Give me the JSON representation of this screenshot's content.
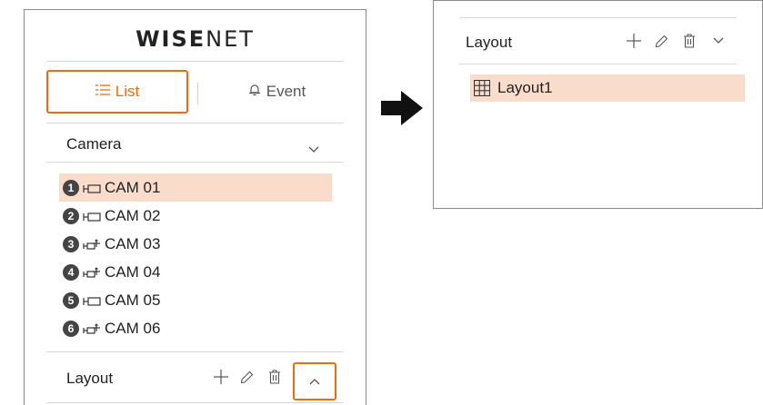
{
  "left_panel": {
    "logo_bold": "WISE",
    "logo_thin": "NET",
    "tabs": [
      {
        "label": "List",
        "icon": "list-icon",
        "active": true
      },
      {
        "label": "Event",
        "icon": "bell-icon",
        "active": false
      }
    ],
    "camera_section": {
      "label": "Camera",
      "icon": "chevron-down-icon"
    },
    "cameras": [
      {
        "num": "1",
        "name": "CAM 01",
        "icon": "camera-icon",
        "selected": true
      },
      {
        "num": "2",
        "name": "CAM 02",
        "icon": "camera-icon",
        "selected": false
      },
      {
        "num": "3",
        "name": "CAM 03",
        "icon": "ptz-camera-icon",
        "selected": false
      },
      {
        "num": "4",
        "name": "CAM 04",
        "icon": "ptz-camera-icon",
        "selected": false
      },
      {
        "num": "5",
        "name": "CAM 05",
        "icon": "camera-icon",
        "selected": false
      },
      {
        "num": "6",
        "name": "CAM 06",
        "icon": "ptz-camera-icon",
        "selected": false
      }
    ],
    "layout_section": {
      "label": "Layout",
      "icons": [
        "plus-icon",
        "pencil-icon",
        "trash-icon",
        "chevron-up-icon"
      ]
    }
  },
  "right_panel": {
    "layout_section": {
      "label": "Layout",
      "icons": [
        "plus-icon",
        "pencil-icon",
        "trash-icon",
        "chevron-down-icon"
      ]
    },
    "layouts": [
      {
        "name": "Layout1",
        "icon": "grid-icon",
        "selected": true
      }
    ]
  },
  "colors": {
    "accent": "#f06a12",
    "selected_bg": "#fadccb",
    "border": "#8a8a8a",
    "divider": "#d8d8d8"
  }
}
